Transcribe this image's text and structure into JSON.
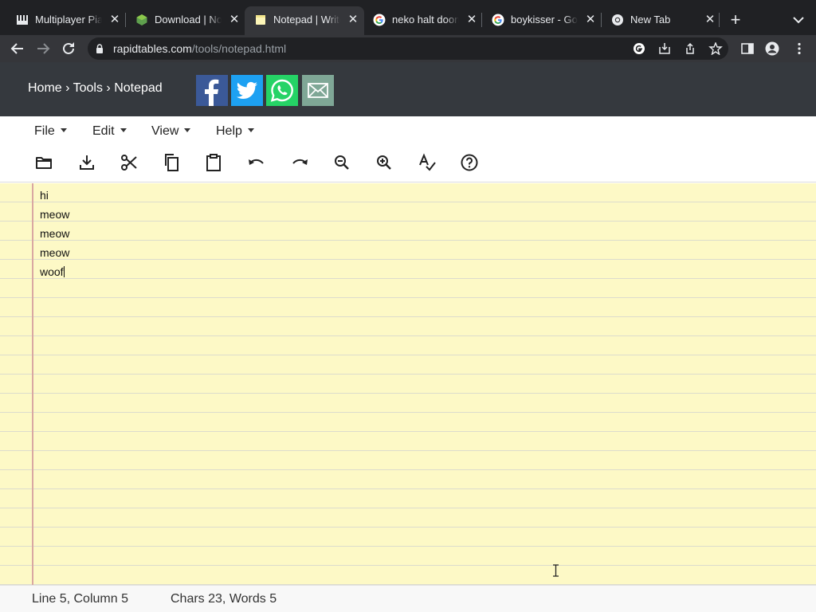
{
  "browser": {
    "tabs": [
      {
        "title": "Multiplayer Piano",
        "icon": "piano-icon",
        "active": false
      },
      {
        "title": "Download | Node.js",
        "icon": "nodejs-icon",
        "active": false
      },
      {
        "title": "Notepad | Write",
        "icon": "notepad-icon",
        "active": true
      },
      {
        "title": "neko halt doorn",
        "icon": "google-icon",
        "active": false
      },
      {
        "title": "boykisser - Goo",
        "icon": "google-icon",
        "active": false
      },
      {
        "title": "New Tab",
        "icon": "chrome-icon",
        "active": false
      }
    ],
    "close_glyph": "✕",
    "new_tab_glyph": "+",
    "url_domain": "rapidtables.com",
    "url_path": "/tools/notepad.html"
  },
  "site": {
    "breadcrumb": {
      "home": "Home",
      "sep": " › ",
      "tools": "Tools",
      "current": "Notepad"
    },
    "share": [
      {
        "name": "facebook",
        "color": "#3b5998"
      },
      {
        "name": "twitter",
        "color": "#1da1f2"
      },
      {
        "name": "whatsapp",
        "color": "#25d366"
      },
      {
        "name": "email",
        "color": "#7fa796"
      }
    ]
  },
  "menu": {
    "file": "File",
    "edit": "Edit",
    "view": "View",
    "help": "Help"
  },
  "toolbar": [
    "open-icon",
    "download-icon",
    "cut-icon",
    "copy-icon",
    "paste-icon",
    "undo-icon",
    "redo-icon",
    "zoom-out-icon",
    "zoom-in-icon",
    "spellcheck-icon",
    "help-icon"
  ],
  "editor": {
    "lines": [
      "hi",
      "meow",
      "meow",
      "meow",
      "woof"
    ],
    "paper_color": "#fdf9c6",
    "margin_color": "#d9a7a2"
  },
  "status": {
    "position": "Line 5, Column 5",
    "counts": "Chars 23, Words 5"
  }
}
